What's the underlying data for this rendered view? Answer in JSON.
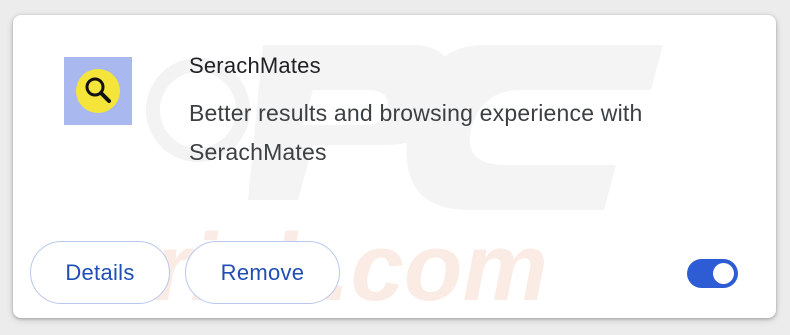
{
  "extension": {
    "name": "SerachMates",
    "description": "Better results and browsing experience with SerachMates",
    "icon": "magnifier-yellow-icon",
    "icon_bg_color": "#a9b8ee",
    "icon_circle_color": "#f5e43a"
  },
  "actions": {
    "details_label": "Details",
    "remove_label": "Remove"
  },
  "toggle": {
    "enabled": true,
    "color": "#2d5cd4"
  },
  "colors": {
    "button_text": "#1f4fb5",
    "button_border": "#b9c7ee"
  }
}
